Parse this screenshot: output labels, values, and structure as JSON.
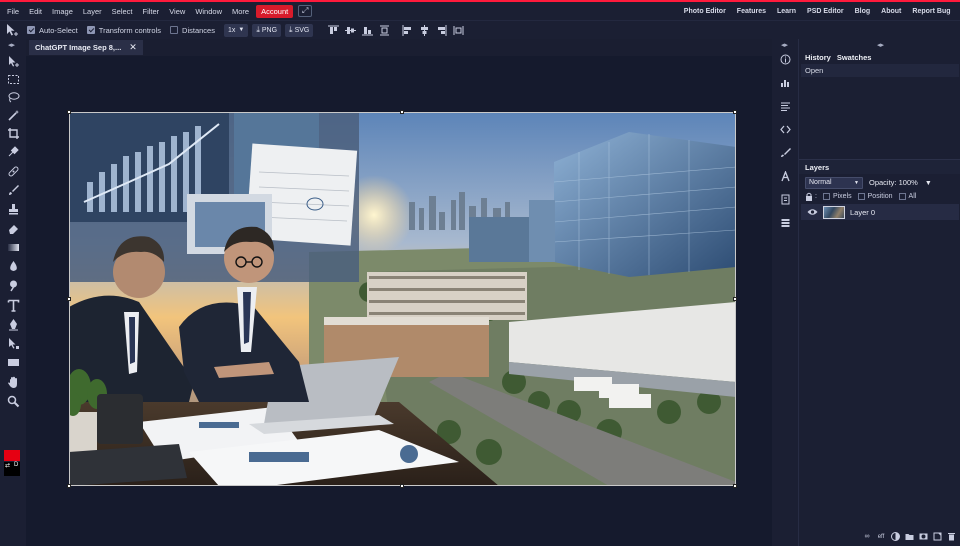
{
  "menubar": {
    "items": [
      "File",
      "Edit",
      "Image",
      "Layer",
      "Select",
      "Filter",
      "View",
      "Window",
      "More"
    ],
    "account_label": "Account",
    "right_links": [
      "Photo Editor",
      "Features",
      "Learn",
      "PSD Editor",
      "Blog",
      "About",
      "Report Bug"
    ],
    "accent_color": "#ff1a3c",
    "account_color": "#d81b2b"
  },
  "toolbar": {
    "auto_select_label": "Auto-Select",
    "auto_select_checked": true,
    "transform_label": "Transform controls",
    "transform_checked": true,
    "distances_label": "Distances",
    "distances_checked": false,
    "zoom_value": "1x",
    "png_label": "PNG",
    "svg_label": "SVG"
  },
  "document": {
    "tab_title": "ChatGPT Image Sep 8,..."
  },
  "colors": {
    "foreground": "#e60012",
    "background": "#000000"
  },
  "history": {
    "tabs": [
      "History",
      "Swatches"
    ],
    "items": [
      "Open"
    ]
  },
  "layers": {
    "title": "Layers",
    "blend_mode": "Normal",
    "opacity_label": "Opacity:",
    "opacity_value": "100%",
    "lock_options": [
      "Pixels",
      "Position",
      "All"
    ],
    "items": [
      {
        "name": "Layer 0",
        "visible": true
      }
    ]
  }
}
